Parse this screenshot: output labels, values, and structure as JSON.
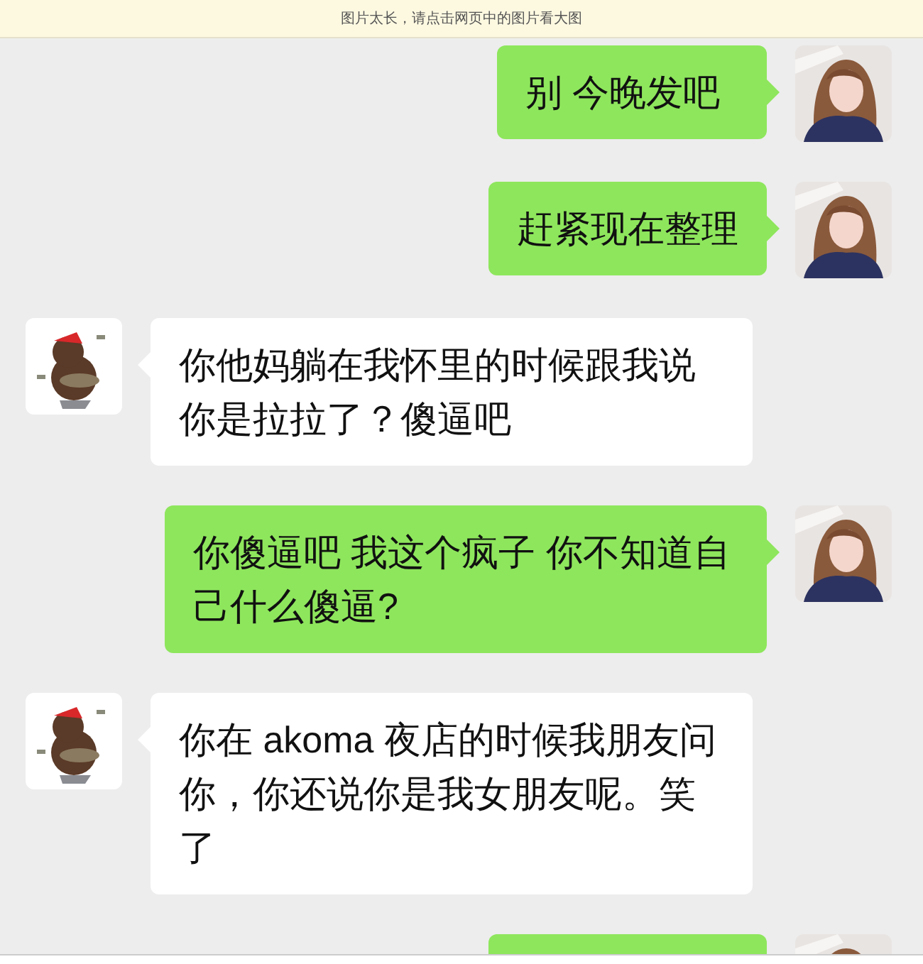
{
  "banner": {
    "text": "图片太长，请点击网页中的图片看大图"
  },
  "messages": [
    {
      "kind": "sent",
      "text": "别 今晚发吧"
    },
    {
      "kind": "sent",
      "text": "赶紧现在整理"
    },
    {
      "kind": "received",
      "text": "你他妈躺在我怀里的时候跟我说你是拉拉了？傻逼吧"
    },
    {
      "kind": "sent",
      "text": "你傻逼吧 我这个疯子 你不知道自己什么傻逼?"
    },
    {
      "kind": "received",
      "text": "你在 akoma 夜店的时候我朋友问你，你还说你是我女朋友呢。笑了"
    },
    {
      "kind": "sent"
    }
  ]
}
